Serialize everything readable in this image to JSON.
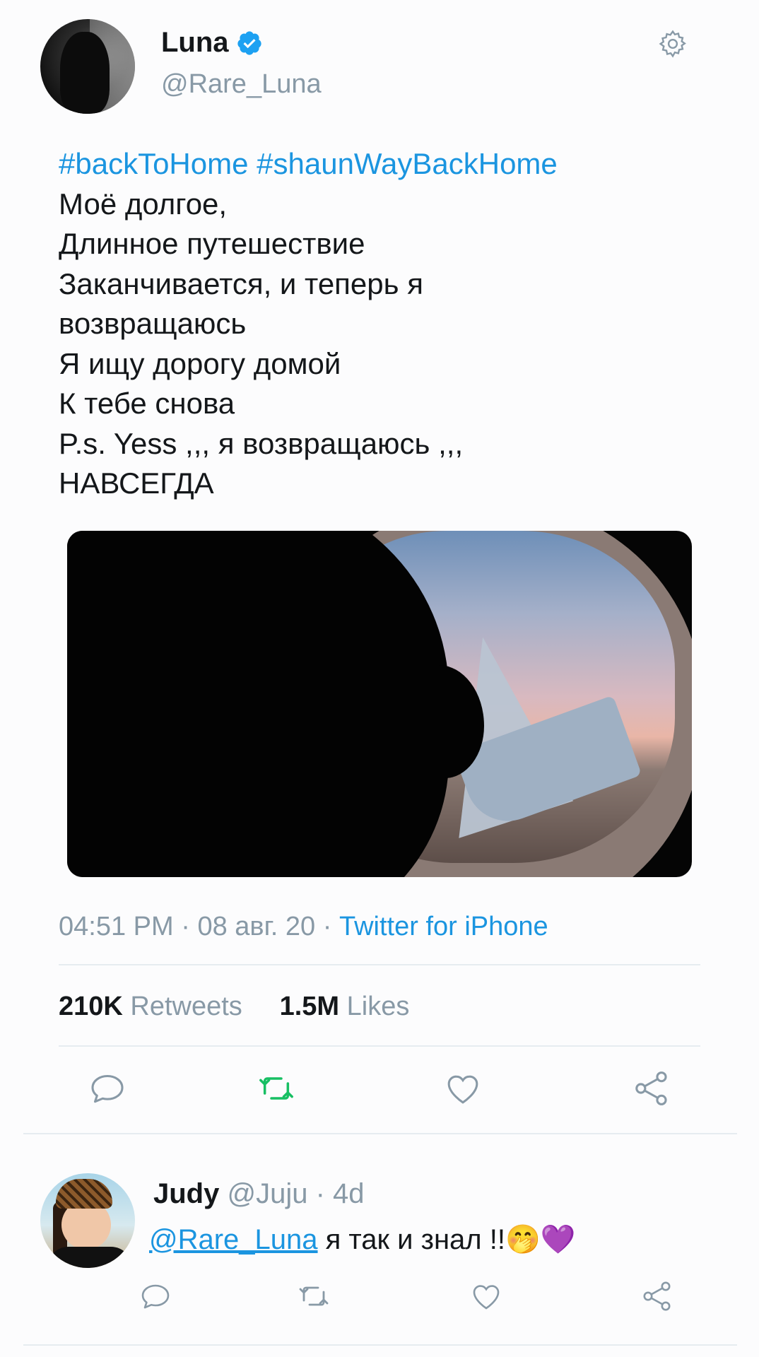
{
  "tweet": {
    "author_name": "Luna",
    "author_handle": "@Rare_Luna",
    "verified": true,
    "hashtags": "#backToHome #shaunWayBackHome",
    "lines": [
      "Моё долгое,",
      "Длинное путешествие",
      "Заканчивается, и теперь я",
      "возвращаюсь",
      "Я ищу дорогу домой",
      "К тебе снова",
      "P.s. Yess ,,, я возвращаюсь ,,,",
      "НАВСЕГДА"
    ],
    "time": "04:51 PM",
    "date": "08 авг. 20",
    "source": "Twitter for iPhone",
    "retweets_count": "210K",
    "retweets_label": "Retweets",
    "likes_count": "1.5M",
    "likes_label": "Likes"
  },
  "reply": {
    "author_name": "Judy",
    "author_handle": "@Juju",
    "age": "4d",
    "mention": "@Rare_Luna",
    "text": " я так и знал !!🤭💜"
  },
  "colors": {
    "link": "#1b95e0",
    "muted": "#8899a6",
    "retweet_active": "#17bf63",
    "divider": "#e6ecf0"
  },
  "icons": {
    "settings": "gear-icon",
    "verified": "verified-badge-icon",
    "reply": "reply-icon",
    "retweet": "retweet-icon",
    "like": "heart-icon",
    "share": "share-icon"
  }
}
